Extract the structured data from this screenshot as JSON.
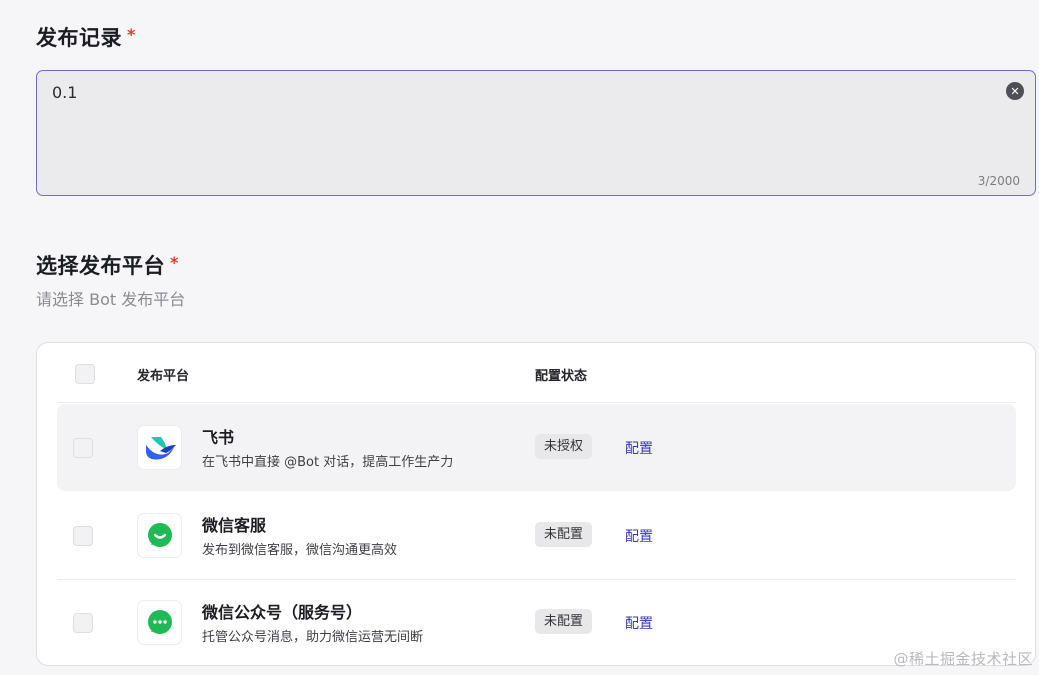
{
  "release_record": {
    "title": "发布记录",
    "required_mark": "*",
    "value": "0.1",
    "char_count": "3/2000"
  },
  "platform_section": {
    "title": "选择发布平台",
    "required_mark": "*",
    "subtitle": "请选择 Bot 发布平台"
  },
  "table": {
    "headers": {
      "platform": "发布平台",
      "status": "配置状态"
    },
    "rows": [
      {
        "name": "飞书",
        "description": "在飞书中直接 @Bot 对话，提高工作生产力",
        "status": "未授权",
        "action": "配置",
        "icon": "feishu-logo-icon"
      },
      {
        "name": "微信客服",
        "description": "发布到微信客服，微信沟通更高效",
        "status": "未配置",
        "action": "配置",
        "icon": "wechat-bubble-icon"
      },
      {
        "name": "微信公众号（服务号）",
        "description": "托管公众号消息，助力微信运营无间断",
        "status": "未配置",
        "action": "配置",
        "icon": "wechat-official-account-icon"
      }
    ]
  },
  "watermark": "@稀土掘金技术社区",
  "colors": {
    "accent": "#3a38b5",
    "input_border": "#6e6cd6",
    "required": "#e03a2f",
    "wechat_green": "#1fb955",
    "feishu_blue": "#2f62f0",
    "feishu_teal": "#21c7b4"
  }
}
